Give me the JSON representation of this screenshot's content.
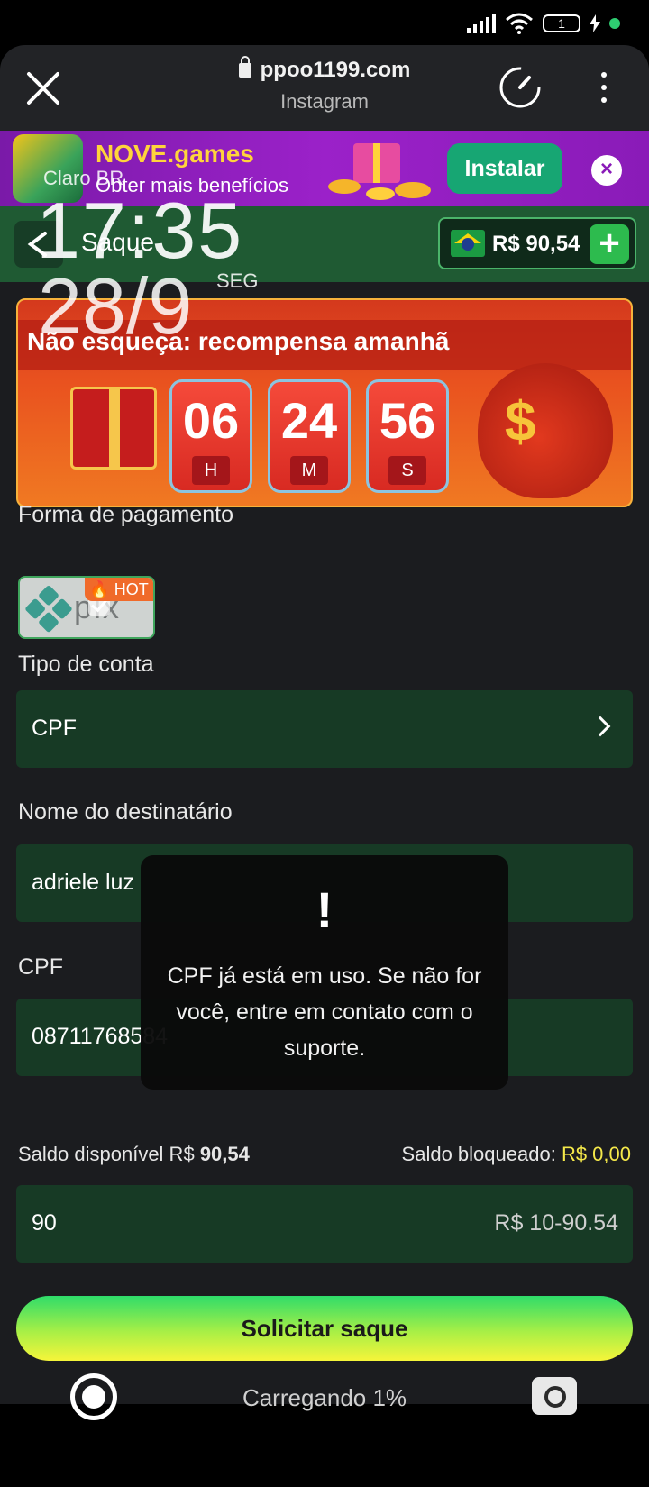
{
  "statusbar": {
    "battery": "1",
    "icons": [
      "signal-icon",
      "wifi-icon",
      "battery-icon",
      "charging-icon"
    ]
  },
  "browser": {
    "url": "ppoo1199.com",
    "source": "Instagram"
  },
  "ad": {
    "title": "NOVE.games",
    "subtitle": "Obter mais benefícios",
    "install_label": "Instalar",
    "close_glyph": "×"
  },
  "header": {
    "title": "Saque",
    "balance": "R$ 90,54",
    "add_glyph": "+"
  },
  "lockscreen": {
    "carrier": "Claro BR",
    "time": "17:35",
    "date": "28/9",
    "weekday": "SEG"
  },
  "promo": {
    "title": "Não esqueça: recompensa amanhã",
    "countdown": [
      {
        "value": "06",
        "unit": "H"
      },
      {
        "value": "24",
        "unit": "M"
      },
      {
        "value": "56",
        "unit": "S"
      }
    ],
    "dollar": "$"
  },
  "payment": {
    "label": "Forma de pagamento",
    "option": "pix",
    "badge": "🔥 HOT"
  },
  "account_type": {
    "label": "Tipo de conta",
    "value": "CPF"
  },
  "recipient": {
    "label": "Nome do destinatário",
    "value": "adriele luz"
  },
  "cpf": {
    "label": "CPF",
    "value": "08711768584"
  },
  "saldo": {
    "available_label": "Saldo disponível R$",
    "available_value": "90,54",
    "blocked_label": "Saldo bloqueado:",
    "blocked_value": "R$ 0,00"
  },
  "amount": {
    "value": "90",
    "range": "R$ 10-90.54"
  },
  "submit_label": "Solicitar saque",
  "toast": {
    "icon": "!",
    "message": "CPF já está em uso. Se não for você, entre em contato com o suporte."
  },
  "recorder": {
    "status": "Carregando 1%"
  },
  "colors": {
    "header_green": "#1f5a33",
    "field_green": "#173a25",
    "accent_yellow": "#f5e94a",
    "ad_purple": "#9b21c9"
  }
}
